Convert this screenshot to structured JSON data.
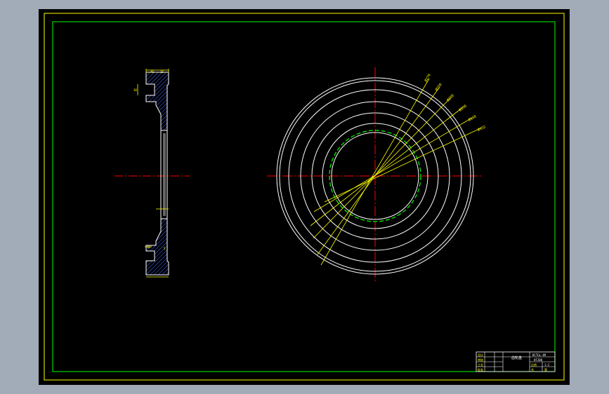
{
  "colors": {
    "background": "#a2acb9",
    "paper": "#000000",
    "outer_frame": "#ffff00",
    "inner_frame": "#00ff00",
    "geometry": "#ffffff",
    "centerline": "#ff0000",
    "dimension": "#ffff00",
    "hatch": "#4a6cff",
    "hidden_circle": "#00ff00"
  },
  "section_view": {
    "dimensions": [
      "40",
      "16",
      "30",
      "16",
      "5"
    ]
  },
  "plan_view": {
    "leaders": [
      "Ø270",
      "Ø250",
      "Ø230",
      "Ø190",
      "Ø160",
      "Ø132"
    ]
  },
  "title_block": {
    "part_title": "齿轮盘",
    "drawing_no": "DCTGL-09",
    "material": "HT200",
    "scale": "1:2",
    "cells": [
      "设计",
      "审核",
      "工艺",
      "批准",
      "比例",
      "数量",
      "共",
      "张",
      "第",
      "张"
    ]
  }
}
